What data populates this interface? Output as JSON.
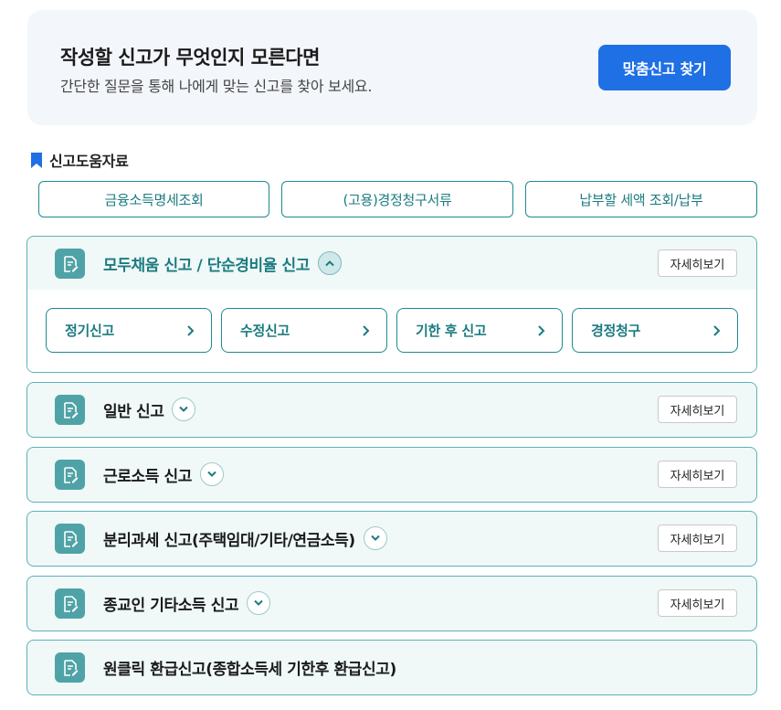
{
  "banner": {
    "title": "작성할 신고가 무엇인지 모른다면",
    "subtitle": "간단한 질문을 통해 나에게 맞는 신고를 찾아 보세요.",
    "button_label": "맞춤신고 찾기"
  },
  "help_section": {
    "title": "신고도움자료",
    "buttons": [
      "금융소득명세조회",
      "(고용)경정청구서류",
      "납부할 세액 조회/납부"
    ]
  },
  "cards": [
    {
      "title": "모두채움 신고 / 단순경비율 신고",
      "detail_label": "자세히보기",
      "expanded": true,
      "sub_items": [
        "정기신고",
        "수정신고",
        "기한 후 신고",
        "경정청구"
      ]
    },
    {
      "title": "일반 신고",
      "detail_label": "자세히보기",
      "expanded": false
    },
    {
      "title": "근로소득 신고",
      "detail_label": "자세히보기",
      "expanded": false
    },
    {
      "title": "분리과세 신고(주택임대/기타/연금소득)",
      "detail_label": "자세히보기",
      "expanded": false
    },
    {
      "title": "종교인 기타소득 신고",
      "detail_label": "자세히보기",
      "expanded": false
    },
    {
      "title": "원클릭 환급신고(종합소득세 기한후 환급신고)"
    }
  ],
  "colors": {
    "primary_blue": "#1f6fe5",
    "teal": "#1b7b80",
    "teal_border": "#5bb3b6",
    "card_bg": "#f0f8f8",
    "icon_bg": "#4fa3a6"
  }
}
